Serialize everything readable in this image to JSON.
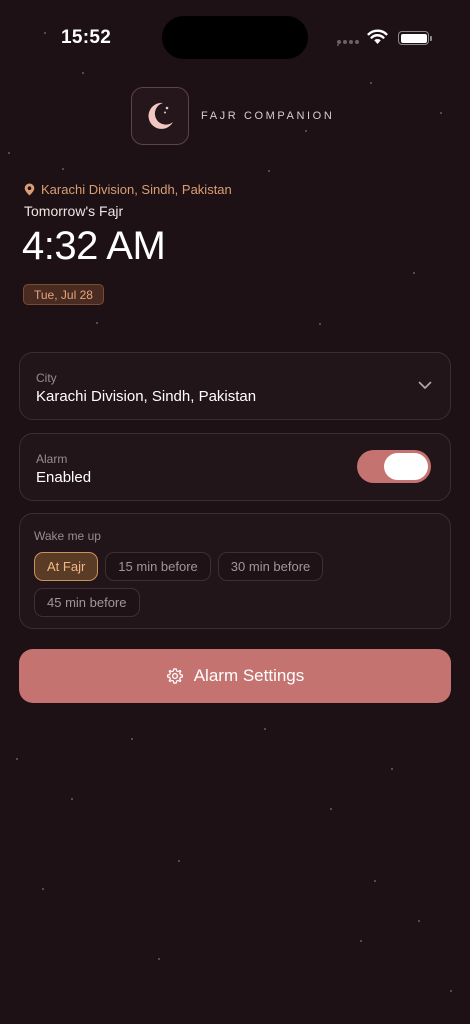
{
  "status_bar": {
    "time": "15:52"
  },
  "brand": {
    "name": "FAJR COMPANION",
    "logo_icon": "crescent-moon-icon"
  },
  "header": {
    "location": "Karachi Division, Sindh, Pakistan",
    "subtitle": "Tomorrow's Fajr",
    "time": "4:32 AM",
    "date": "Tue, Jul 28"
  },
  "city_card": {
    "label": "City",
    "value": "Karachi Division, Sindh, Pakistan"
  },
  "alarm_card": {
    "label": "Alarm",
    "value": "Enabled",
    "enabled": true
  },
  "wake_card": {
    "label": "Wake me up",
    "options": [
      "At Fajr",
      "15 min before",
      "30 min before",
      "45 min before"
    ],
    "selected": "At Fajr"
  },
  "settings_button": {
    "label": "Alarm Settings",
    "icon": "gear-icon"
  },
  "colors": {
    "background": "#1d1115",
    "accent": "#c57370",
    "gold": "#d99f73"
  }
}
